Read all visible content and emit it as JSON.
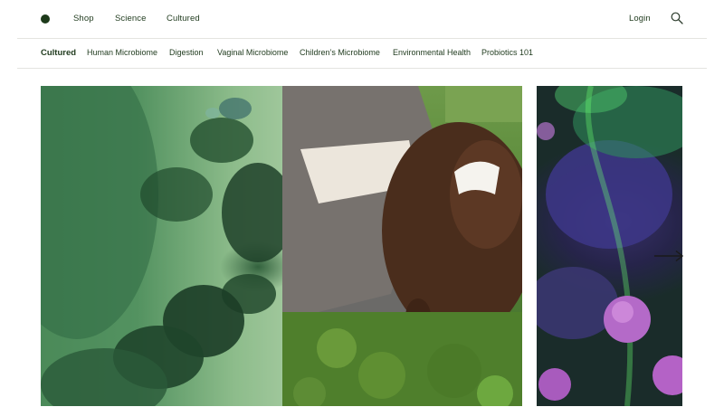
{
  "header": {
    "nav": {
      "shop": "Shop",
      "science": "Science",
      "cultured": "Cultured",
      "login": "Login"
    },
    "icons": {
      "logo": "logo-dot",
      "search": "search-icon"
    }
  },
  "subnav": {
    "items": [
      {
        "label": "Cultured",
        "active": true
      },
      {
        "label": "Human Microbiome",
        "active": false
      },
      {
        "label": "Digestion",
        "active": false
      },
      {
        "label": "Vaginal Microbiome",
        "active": false
      },
      {
        "label": "Children’s Microbiome",
        "active": false
      },
      {
        "label": "Environmental Health",
        "active": false
      },
      {
        "label": "Probiotics 101",
        "active": false
      }
    ]
  },
  "carousel": {
    "next_icon": "arrow-right-icon"
  },
  "colors": {
    "brand_dark_green": "#1d3a1a",
    "divider": "#e4e4e0",
    "background": "#ffffff"
  }
}
